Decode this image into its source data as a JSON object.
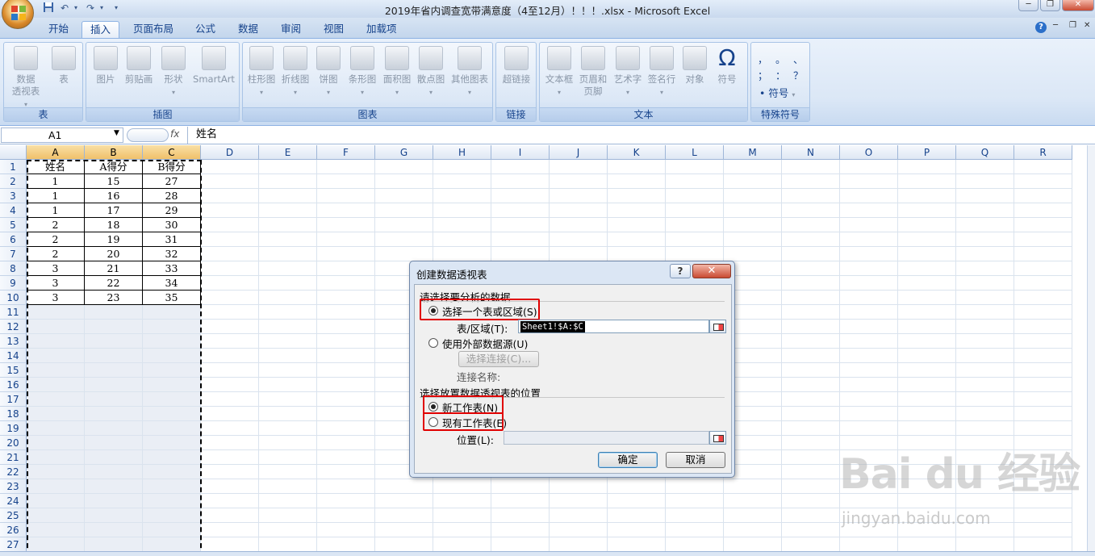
{
  "window": {
    "title": "2019年省内调查宽带满意度（4至12月）！！！.xlsx - Microsoft Excel"
  },
  "quick_access": {
    "save_icon": "save-icon",
    "undo_icon": "undo-icon",
    "redo_icon": "redo-icon"
  },
  "tabs": [
    "开始",
    "插入",
    "页面布局",
    "公式",
    "数据",
    "审阅",
    "视图",
    "加载项"
  ],
  "active_tab": "插入",
  "ribbon": {
    "groups": [
      {
        "caption": "表",
        "buttons": [
          "数据\n透视表",
          "表"
        ]
      },
      {
        "caption": "插图",
        "buttons": [
          "图片",
          "剪贴画",
          "形状",
          "SmartArt"
        ]
      },
      {
        "caption": "图表",
        "buttons": [
          "柱形图",
          "折线图",
          "饼图",
          "条形图",
          "面积图",
          "散点图",
          "其他图表"
        ]
      },
      {
        "caption": "链接",
        "buttons": [
          "超链接"
        ]
      },
      {
        "caption": "文本",
        "buttons": [
          "文本框",
          "页眉和\n页脚",
          "艺术字",
          "签名行",
          "对象",
          "符号"
        ]
      },
      {
        "caption": "特殊符号",
        "buttons": [
          "符号"
        ]
      }
    ],
    "special_symbols": [
      "，",
      "。",
      "、",
      "；",
      "：",
      "？"
    ]
  },
  "formula_bar": {
    "name_box": "A1",
    "fx": "fx",
    "content": "姓名"
  },
  "columns": [
    "A",
    "B",
    "C",
    "D",
    "E",
    "F",
    "G",
    "H",
    "I",
    "J",
    "K",
    "L",
    "M",
    "N",
    "O",
    "P",
    "Q",
    "R"
  ],
  "rows": [
    "1",
    "2",
    "3",
    "4",
    "5",
    "6",
    "7",
    "8",
    "9",
    "10",
    "11",
    "12",
    "13",
    "14",
    "15",
    "16",
    "17",
    "18",
    "19",
    "20",
    "21",
    "22",
    "23",
    "24",
    "25",
    "26",
    "27"
  ],
  "table": {
    "headers": [
      "姓名",
      "A得分",
      "B得分"
    ],
    "data": [
      [
        "1",
        "15",
        "27"
      ],
      [
        "1",
        "16",
        "28"
      ],
      [
        "1",
        "17",
        "29"
      ],
      [
        "2",
        "18",
        "30"
      ],
      [
        "2",
        "19",
        "31"
      ],
      [
        "2",
        "20",
        "32"
      ],
      [
        "3",
        "21",
        "33"
      ],
      [
        "3",
        "22",
        "34"
      ],
      [
        "3",
        "23",
        "35"
      ]
    ]
  },
  "dialog": {
    "title": "创建数据透视表",
    "help": "?",
    "close": "✕",
    "section1": "请选择要分析的数据",
    "opt_range": "选择一个表或区域(S)",
    "range_label": "表/区域(T):",
    "range_value": "Sheet1!$A:$C",
    "opt_external": "使用外部数据源(U)",
    "choose_conn": "选择连接(C)...",
    "conn_name": "连接名称:",
    "section2": "选择放置数据透视表的位置",
    "opt_new": "新工作表(N)",
    "opt_existing": "现有工作表(E)",
    "location_label": "位置(L):",
    "location_value": "",
    "ok": "确定",
    "cancel": "取消"
  },
  "watermark": {
    "brand": "Bai du 经验",
    "url": "jingyan.baidu.com"
  }
}
